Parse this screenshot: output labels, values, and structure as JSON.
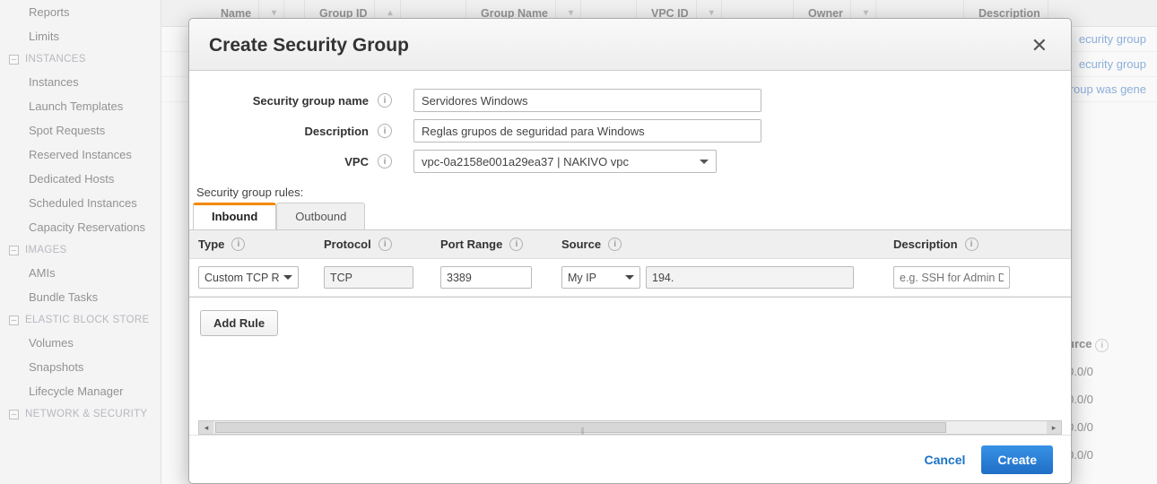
{
  "sidebar": {
    "items": [
      {
        "label": "Reports",
        "type": "item"
      },
      {
        "label": "Limits",
        "type": "item"
      },
      {
        "label": "INSTANCES",
        "type": "head"
      },
      {
        "label": "Instances",
        "type": "item"
      },
      {
        "label": "Launch Templates",
        "type": "item"
      },
      {
        "label": "Spot Requests",
        "type": "item"
      },
      {
        "label": "Reserved Instances",
        "type": "item"
      },
      {
        "label": "Dedicated Hosts",
        "type": "item"
      },
      {
        "label": "Scheduled Instances",
        "type": "item"
      },
      {
        "label": "Capacity Reservations",
        "type": "item"
      },
      {
        "label": "IMAGES",
        "type": "head"
      },
      {
        "label": "AMIs",
        "type": "item"
      },
      {
        "label": "Bundle Tasks",
        "type": "item"
      },
      {
        "label": "ELASTIC BLOCK STORE",
        "type": "head"
      },
      {
        "label": "Volumes",
        "type": "item"
      },
      {
        "label": "Snapshots",
        "type": "item"
      },
      {
        "label": "Lifecycle Manager",
        "type": "item"
      },
      {
        "label": "NETWORK & SECURITY",
        "type": "head"
      }
    ]
  },
  "back_table": {
    "columns": {
      "name": "Name",
      "group_id": "Group ID",
      "group_name": "Group Name",
      "vpc_id": "VPC ID",
      "owner": "Owner",
      "description": "Description"
    },
    "desc_cells": [
      "ecurity group",
      "ecurity group",
      "group was gene"
    ],
    "detail_header": "urce",
    "detail_rows": [
      "0.0/0",
      "0.0/0",
      "0.0/0",
      "0.0/0"
    ]
  },
  "modal": {
    "title": "Create Security Group",
    "form": {
      "name_label": "Security group name",
      "name_value": "Servidores Windows",
      "desc_label": "Description",
      "desc_value": "Reglas grupos de seguridad para Windows",
      "vpc_label": "VPC",
      "vpc_value": "vpc-0a2158e001a29ea37 | NAKIVO vpc"
    },
    "rules_label": "Security group rules:",
    "tabs": {
      "inbound": "Inbound",
      "outbound": "Outbound"
    },
    "headers": {
      "type": "Type",
      "protocol": "Protocol",
      "port": "Port Range",
      "source": "Source",
      "desc": "Description"
    },
    "row": {
      "type": "Custom TCP R",
      "protocol": "TCP",
      "port": "3389",
      "source_mode": "My IP",
      "source_value": "194.",
      "desc_placeholder": "e.g. SSH for Admin D"
    },
    "add_rule": "Add Rule",
    "cancel": "Cancel",
    "create": "Create"
  }
}
